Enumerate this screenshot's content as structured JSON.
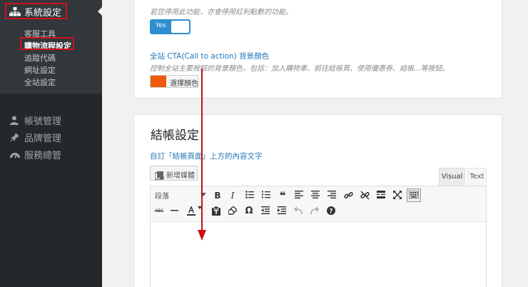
{
  "sidebar": {
    "active_menu": "系統設定",
    "submenu": [
      "客服工具",
      "購物流程設定",
      "追蹤代碼",
      "網址設定",
      "全站設定"
    ],
    "current_submenu": "購物流程設定",
    "menu_items": [
      {
        "label": "帳號管理",
        "icon": "user-icon"
      },
      {
        "label": "品牌管理",
        "icon": "pin-icon"
      },
      {
        "label": "服務總管",
        "icon": "gauge-icon"
      }
    ]
  },
  "top_panel": {
    "disable_note": "若您停用此功能，亦會停用紅利點數的功能。",
    "toggle_label": "Yes",
    "cta_title": "全站 CTA(Call to action) 背景顏色",
    "cta_desc": "控制全站主要按鈕的背景顏色，包括：加入購物車、前往結帳頁、使用優惠券、結帳...等按鈕。",
    "color_button": "選擇顏色",
    "swatch_color": "#f15a0b"
  },
  "checkout": {
    "section_title": "結帳設定",
    "field_title": "自訂「結帳頁面」上方的內容文字",
    "add_media": "新增媒體",
    "tab_visual": "Visual",
    "tab_text": "Text",
    "format_select": "段落"
  },
  "colors": {
    "accent_blue": "#2e8fd0",
    "annotation_red": "#d0111b",
    "sidebar_bg": "#23282d"
  }
}
